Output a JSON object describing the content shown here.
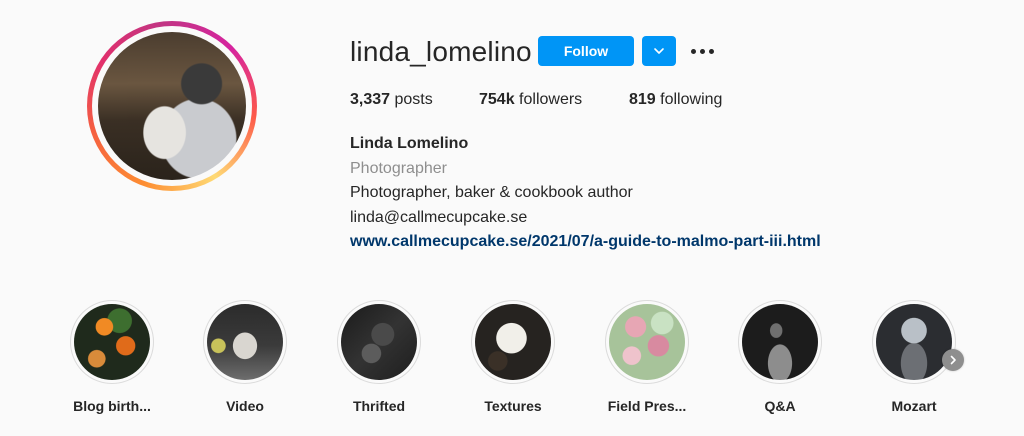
{
  "profile": {
    "username": "linda_lomelino",
    "follow_label": "Follow",
    "stats": {
      "posts_count": "3,337",
      "posts_label": "posts",
      "followers_count": "754k",
      "followers_label": "followers",
      "following_count": "819",
      "following_label": "following"
    },
    "bio": {
      "name": "Linda Lomelino",
      "category": "Photographer",
      "line1": "Photographer, baker & cookbook author",
      "line2": "linda@callmecupcake.se",
      "link": "www.callmecupcake.se/2021/07/a-guide-to-malmo-part-iii.html"
    }
  },
  "highlights": [
    {
      "label": "Blog birth..."
    },
    {
      "label": "Video"
    },
    {
      "label": "Thrifted"
    },
    {
      "label": "Textures"
    },
    {
      "label": "Field Pres..."
    },
    {
      "label": "Q&A"
    },
    {
      "label": "Mozart"
    }
  ],
  "colors": {
    "accent": "#0095f6",
    "link": "#00376b",
    "muted": "#8e8e8e",
    "text": "#262626",
    "background": "#fafafa"
  },
  "icons": {
    "dropdown": "chevron-down-icon",
    "more": "more-options-icon",
    "scroll": "chevron-right-icon"
  }
}
